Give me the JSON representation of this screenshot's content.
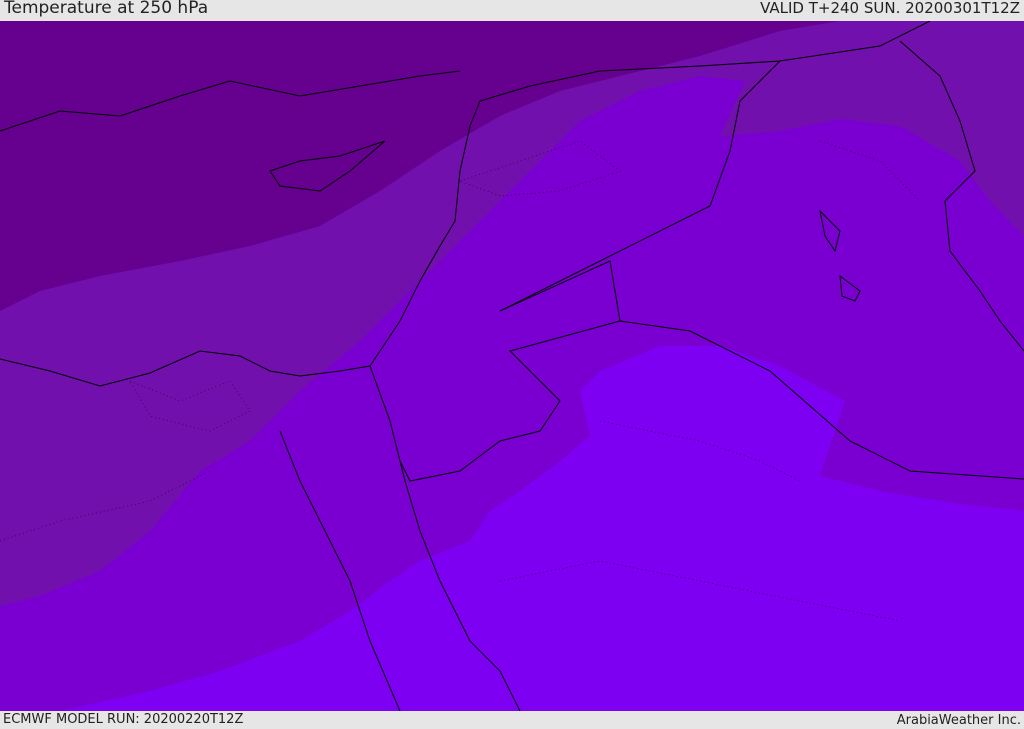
{
  "header": {
    "title": "Temperature at 250 hPa",
    "valid": "VALID T+240 SUN. 20200301T12Z"
  },
  "footer": {
    "model_run": "ECMWF MODEL RUN: 20200220T12Z",
    "credit": "ArabiaWeather Inc."
  },
  "colors": {
    "band_coldest": "#65008f",
    "band_cold": "#7110ad",
    "band_mid": "#7a00d1",
    "band_warm": "#7e00f2",
    "border": "#000000"
  }
}
